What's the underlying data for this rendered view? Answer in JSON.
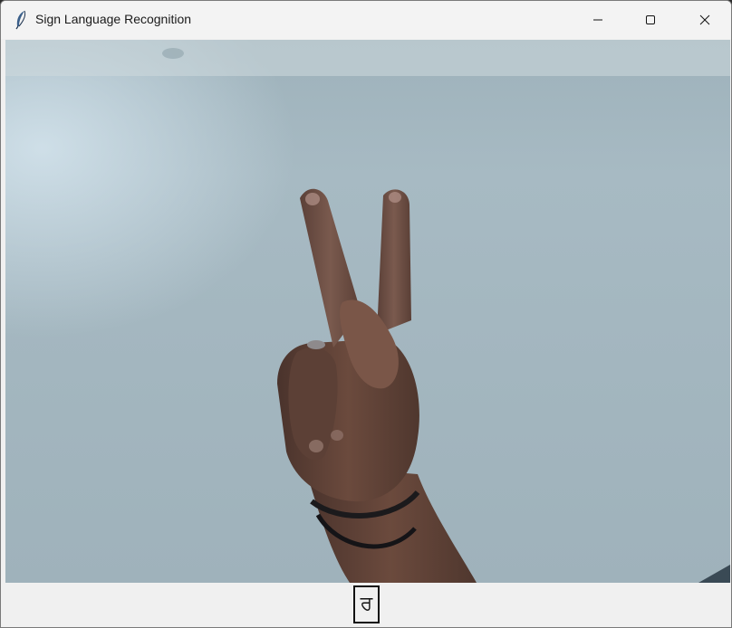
{
  "window": {
    "title": "Sign Language Recognition",
    "controls": {
      "minimize": "minimize-icon",
      "maximize": "maximize-icon",
      "close": "close-icon"
    },
    "app_icon": "feather-icon"
  },
  "video": {
    "content": "webcam-feed-hand-sign"
  },
  "prediction": {
    "text": "ਰ"
  },
  "colors": {
    "titlebar": "#f3f3f3",
    "window_bg": "#f0f0f0",
    "video_bg": "#a3b6bf",
    "label_border": "#111111"
  }
}
